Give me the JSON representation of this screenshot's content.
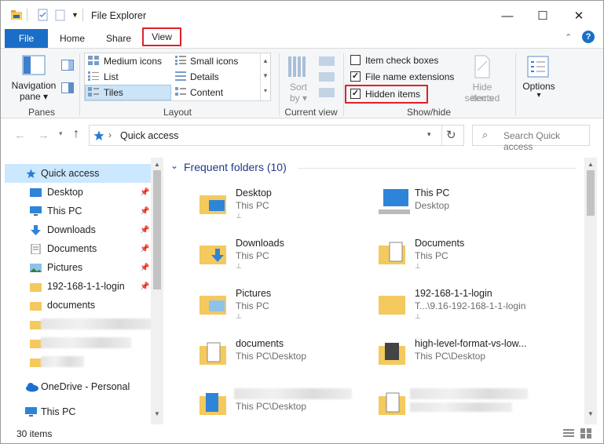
{
  "window": {
    "title": "File Explorer",
    "minimize_glyph": "—",
    "maximize_glyph": "☐",
    "close_glyph": "✕"
  },
  "tabs": {
    "file": "File",
    "home": "Home",
    "share": "Share",
    "view": "View"
  },
  "ribbon": {
    "panes": {
      "navigation_pane": "Navigation",
      "navigation_pane_2": "pane ▾",
      "label": "Panes"
    },
    "layout": {
      "medium_icons": "Medium icons",
      "small_icons": "Small icons",
      "list": "List",
      "details": "Details",
      "tiles": "Tiles",
      "content": "Content",
      "label": "Layout"
    },
    "current_view": {
      "sort_by": "Sort",
      "sort_by_2": "by ▾",
      "label": "Current view"
    },
    "show_hide": {
      "item_check_boxes": "Item check boxes",
      "file_name_extensions": "File name extensions",
      "hidden_items": "Hidden items",
      "hide_selected": "Hide selected",
      "hide_selected_2": "items",
      "label": "Show/hide"
    },
    "options": {
      "label": "Options",
      "arrow": "▾"
    }
  },
  "address": {
    "path": "Quick access",
    "search_placeholder": "Search Quick access"
  },
  "sidebar": {
    "quick_access": "Quick access",
    "items": [
      {
        "label": "Desktop"
      },
      {
        "label": "This PC"
      },
      {
        "label": "Downloads"
      },
      {
        "label": "Documents"
      },
      {
        "label": "Pictures"
      },
      {
        "label": "192-168-1-1-login"
      },
      {
        "label": "documents"
      }
    ],
    "onedrive": "OneDrive - Personal",
    "this_pc": "This PC"
  },
  "main": {
    "section_title": "Frequent folders (10)",
    "tiles": [
      {
        "name": "Desktop",
        "sub": "This PC"
      },
      {
        "name": "This PC",
        "sub": "Desktop"
      },
      {
        "name": "Downloads",
        "sub": "This PC"
      },
      {
        "name": "Documents",
        "sub": "This PC"
      },
      {
        "name": "Pictures",
        "sub": "This PC"
      },
      {
        "name": "192-168-1-1-login",
        "sub": "T...\\9.16-192-168-1-1-login"
      },
      {
        "name": "documents",
        "sub": "This PC\\Desktop"
      },
      {
        "name": "high-level-format-vs-low...",
        "sub": "This PC\\Desktop"
      },
      {
        "name": "",
        "sub": "This PC\\Desktop"
      },
      {
        "name": "",
        "sub": ""
      }
    ]
  },
  "status": {
    "count": "30 items"
  },
  "colors": {
    "accent": "#1a6ec7",
    "highlight": "#e0202a",
    "folder": "#f4c95d"
  }
}
